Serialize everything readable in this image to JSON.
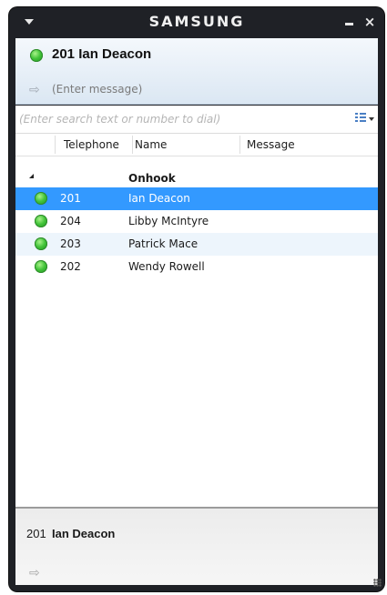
{
  "titlebar": {
    "brand": "SAMSUNG"
  },
  "header": {
    "current_user": "201 Ian Deacon",
    "status_color": "#43c43a",
    "message_placeholder": "(Enter message)"
  },
  "search": {
    "placeholder": "(Enter search text or number to dial)"
  },
  "columns": {
    "telephone": "Telephone",
    "name": "Name",
    "message": "Message"
  },
  "group": {
    "label": "Onhook"
  },
  "contacts": [
    {
      "telephone": "201",
      "name": "Ian Deacon",
      "selected": true
    },
    {
      "telephone": "204",
      "name": "Libby McIntyre",
      "selected": false
    },
    {
      "telephone": "203",
      "name": "Patrick Mace",
      "selected": false
    },
    {
      "telephone": "202",
      "name": "Wendy Rowell",
      "selected": false
    }
  ],
  "bottom": {
    "telephone": "201",
    "name": "Ian Deacon"
  },
  "colors": {
    "selection": "#3399ff",
    "window": "#1f2126"
  }
}
